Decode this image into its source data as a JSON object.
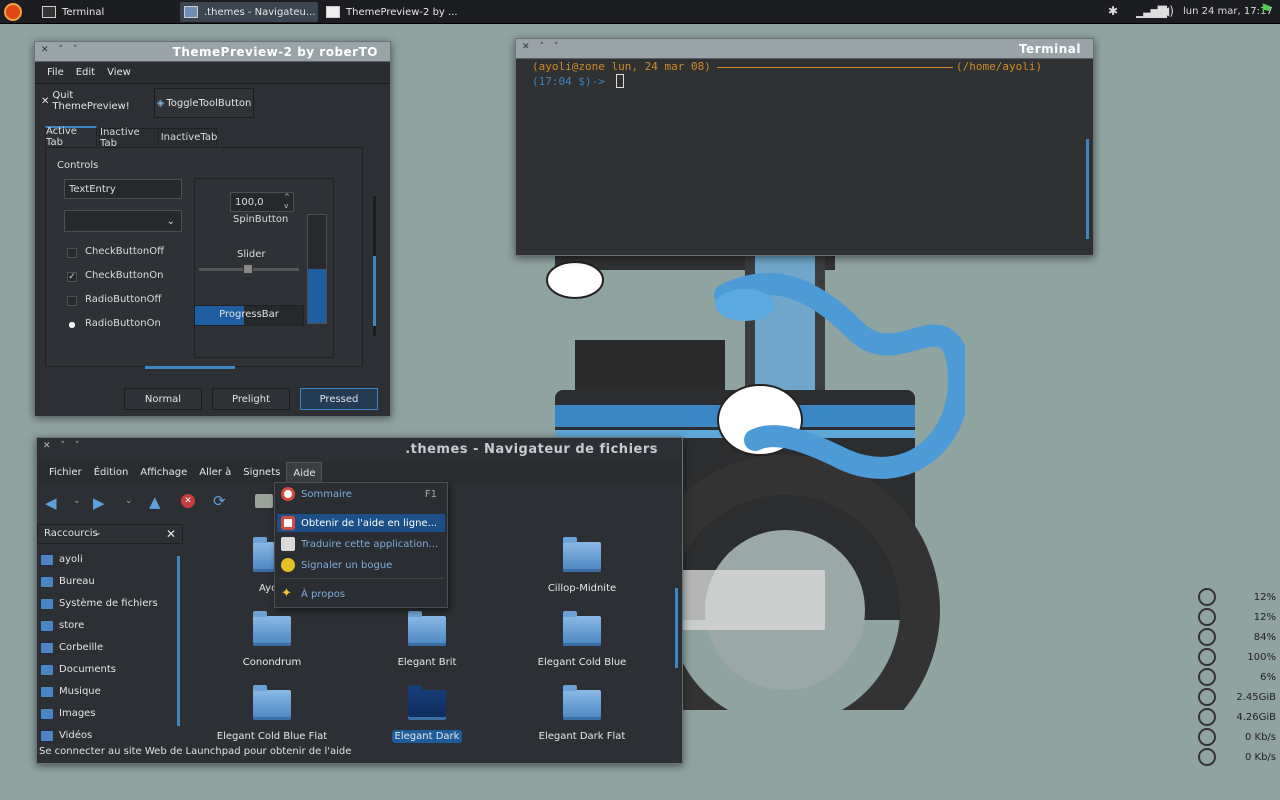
{
  "panel": {
    "tasks": [
      {
        "label": "Terminal"
      },
      {
        "label": ".themes - Navigateu..."
      },
      {
        "label": "ThemePreview-2 by ..."
      }
    ],
    "clock": "lun 24 mar, 17:17"
  },
  "theme_preview": {
    "title": "ThemePreview-2 by roberTO",
    "menu": [
      "File",
      "Edit",
      "View"
    ],
    "toolbar": {
      "quit": "Quit ThemePreview!",
      "toggle": "ToggleToolButton"
    },
    "tabs": [
      "Active Tab",
      "Inactive Tab",
      "InactiveTab"
    ],
    "controls_label": "Controls",
    "text_entry": "TextEntry",
    "spin_value": "100,0",
    "spin_label": "SpinButton",
    "slider_label": "Slider",
    "progress_label": "ProgressBar",
    "progress_fraction": 0.45,
    "vertical_progress_fraction": 0.5,
    "checks": [
      {
        "label": "CheckButtonOff",
        "checked": false
      },
      {
        "label": "CheckButtonOn",
        "checked": true
      },
      {
        "label": "RadioButtonOff",
        "checked": false
      },
      {
        "label": "RadioButtonOn",
        "checked": true
      }
    ],
    "buttons": [
      "Normal",
      "Prelight",
      "Pressed"
    ]
  },
  "terminal": {
    "title": "Terminal",
    "line1_user": "(ayoli@zone lun, 24 mar 08)",
    "line1_path": "(/home/ayoli)",
    "line2": "(17:04 $)->"
  },
  "file_manager": {
    "title": ".themes - Navigateur de fichiers",
    "menu": [
      "Fichier",
      "Édition",
      "Affichage",
      "Aller à",
      "Signets",
      "Aide"
    ],
    "side_header": "Raccourcis",
    "side_items": [
      "ayoli",
      "Bureau",
      "Système de fichiers",
      "store",
      "Corbeille",
      "Documents",
      "Musique",
      "Images",
      "Vidéos"
    ],
    "folders_row1": [
      "AyoG",
      "Cillop-Midnite"
    ],
    "folders_row2": [
      "Conondrum",
      "Elegant Brit",
      "Elegant Cold Blue"
    ],
    "folders_row3": [
      "Elegant Cold Blue Flat",
      "Elegant Dark",
      "Elegant Dark Flat"
    ],
    "status": "Se connecter au site Web de Launchpad pour obtenir de l'aide"
  },
  "help_menu": {
    "items": [
      {
        "label": "Sommaire",
        "shortcut": "F1"
      },
      {
        "label": "Obtenir de l'aide en ligne..."
      },
      {
        "label": "Traduire cette application..."
      },
      {
        "label": "Signaler un bogue"
      },
      {
        "label": "À propos"
      }
    ]
  },
  "conky": {
    "values": [
      "12%",
      "12%",
      "84%",
      "100%",
      "6%",
      "2.45GiB",
      "4.26GiB",
      "0 Kb/s",
      "0 Kb/s"
    ]
  },
  "colors": {
    "accent": "#3d86c6",
    "selection": "#1d4f86",
    "terminal_text": "#d08a28"
  }
}
